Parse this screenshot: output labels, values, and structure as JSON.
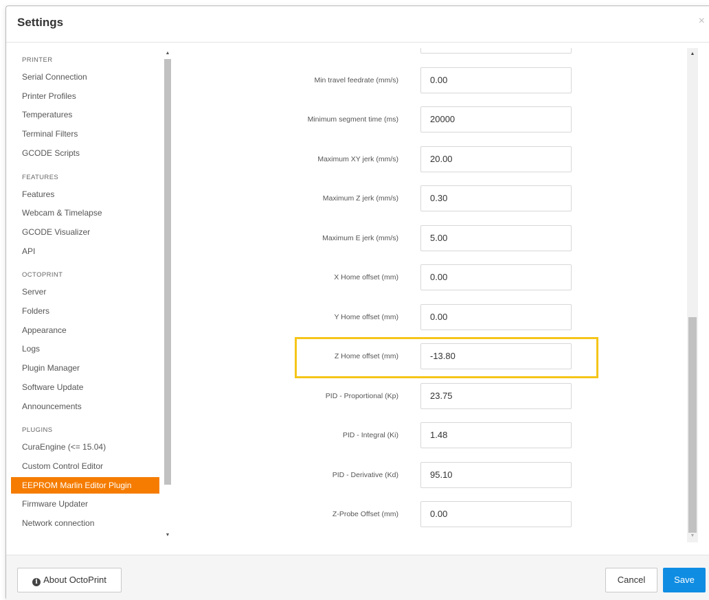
{
  "dialog": {
    "title": "Settings",
    "close_symbol": "×"
  },
  "sidebar": {
    "sections": [
      {
        "header": "PRINTER",
        "items": [
          "Serial Connection",
          "Printer Profiles",
          "Temperatures",
          "Terminal Filters",
          "GCODE Scripts"
        ]
      },
      {
        "header": "FEATURES",
        "items": [
          "Features",
          "Webcam & Timelapse",
          "GCODE Visualizer",
          "API"
        ]
      },
      {
        "header": "OCTOPRINT",
        "items": [
          "Server",
          "Folders",
          "Appearance",
          "Logs",
          "Plugin Manager",
          "Software Update",
          "Announcements"
        ]
      },
      {
        "header": "PLUGINS",
        "items": [
          "CuraEngine (<= 15.04)",
          "Custom Control Editor",
          "EEPROM Marlin Editor Plugin",
          "Firmware Updater",
          "Network connection"
        ]
      }
    ],
    "active_item": "EEPROM Marlin Editor Plugin",
    "scroll_up_icon": "arrow-up-icon",
    "scroll_down_icon": "arrow-down-icon"
  },
  "form": {
    "fields": [
      {
        "label": "",
        "value": ""
      },
      {
        "label": "Min travel feedrate (mm/s)",
        "value": "0.00"
      },
      {
        "label": "Minimum segment time (ms)",
        "value": "20000"
      },
      {
        "label": "Maximum XY jerk (mm/s)",
        "value": "20.00"
      },
      {
        "label": "Maximum Z jerk (mm/s)",
        "value": "0.30"
      },
      {
        "label": "Maximum E jerk (mm/s)",
        "value": "5.00"
      },
      {
        "label": "X Home offset (mm)",
        "value": "0.00"
      },
      {
        "label": "Y Home offset (mm)",
        "value": "0.00"
      },
      {
        "label": "Z Home offset (mm)",
        "value": "-13.80"
      },
      {
        "label": "PID - Proportional (Kp)",
        "value": "23.75"
      },
      {
        "label": "PID - Integral (Ki)",
        "value": "1.48"
      },
      {
        "label": "PID - Derivative (Kd)",
        "value": "95.10"
      },
      {
        "label": "Z-Probe Offset (mm)",
        "value": "0.00"
      }
    ],
    "highlighted_field": "Z Home offset (mm)",
    "highlight_color": "#f5c518"
  },
  "footer": {
    "about_label": "About OctoPrint",
    "about_icon": "info-circle-icon",
    "cancel_label": "Cancel",
    "save_label": "Save"
  },
  "colors": {
    "active_nav": "#f57c00",
    "save_button": "#0f8de3"
  }
}
